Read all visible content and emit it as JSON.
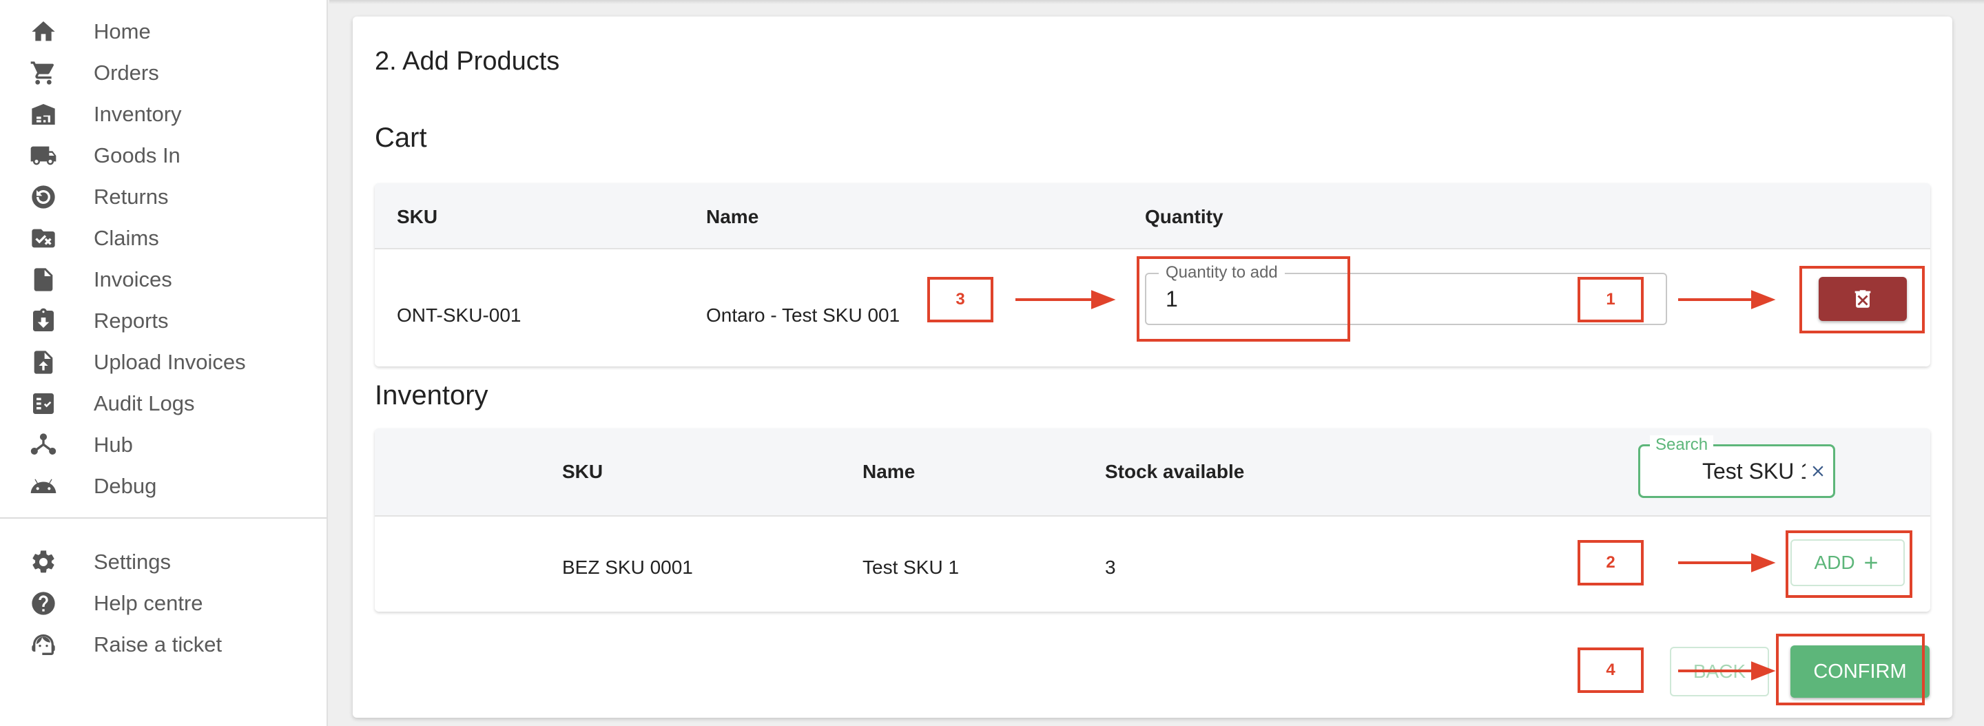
{
  "sidebar": {
    "items": [
      {
        "label": "Home",
        "icon": "home-icon"
      },
      {
        "label": "Orders",
        "icon": "cart-icon"
      },
      {
        "label": "Inventory",
        "icon": "warehouse-icon"
      },
      {
        "label": "Goods In",
        "icon": "truck-icon"
      },
      {
        "label": "Returns",
        "icon": "returns-icon"
      },
      {
        "label": "Claims",
        "icon": "claims-folder-icon"
      },
      {
        "label": "Invoices",
        "icon": "document-icon"
      },
      {
        "label": "Reports",
        "icon": "clipboard-download-icon"
      },
      {
        "label": "Upload Invoices",
        "icon": "file-upload-icon"
      },
      {
        "label": "Audit Logs",
        "icon": "checklist-icon"
      },
      {
        "label": "Hub",
        "icon": "hub-icon"
      },
      {
        "label": "Debug",
        "icon": "android-icon"
      }
    ],
    "secondary": [
      {
        "label": "Settings",
        "icon": "gear-icon"
      },
      {
        "label": "Help centre",
        "icon": "help-icon"
      },
      {
        "label": "Raise a ticket",
        "icon": "support-agent-icon"
      }
    ]
  },
  "main": {
    "step_title": "2. Add Products",
    "cart": {
      "title": "Cart",
      "columns": [
        "SKU",
        "Name",
        "Quantity"
      ],
      "rows": [
        {
          "sku": "ONT-SKU-001",
          "name": "Ontaro - Test SKU 001",
          "quantity_label": "Quantity to add",
          "quantity_value": "1"
        }
      ]
    },
    "inventory": {
      "title": "Inventory",
      "columns": [
        "SKU",
        "Name",
        "Stock available"
      ],
      "search_label": "Search",
      "search_value": "Test SKU 1",
      "rows": [
        {
          "sku": "BEZ SKU 0001",
          "name": "Test SKU 1",
          "stock": "3",
          "add_label": "ADD"
        }
      ]
    },
    "buttons": {
      "back": "BACK",
      "confirm": "CONFIRM"
    }
  },
  "annotations": [
    "1",
    "2",
    "3",
    "4"
  ],
  "colors": {
    "primary_green": "#5db67a",
    "delete_red": "#9b3636",
    "annotation_red": "#e0432b",
    "header_bg": "#f5f6f8"
  }
}
